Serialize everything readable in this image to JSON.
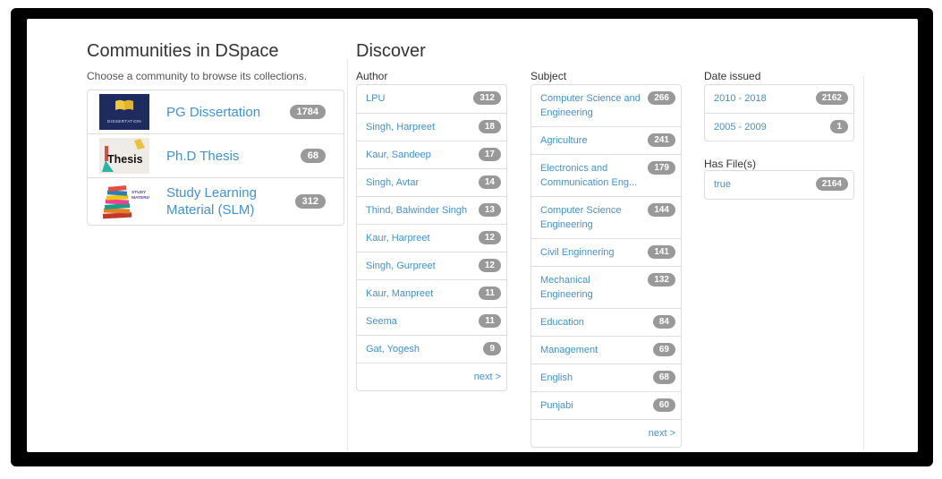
{
  "colors": {
    "link_blue": "#4191d6",
    "badge_gray": "#999999",
    "frame_black": "#000000",
    "divider_gray": "#e7e7e7"
  },
  "communities": {
    "title": "Communities in DSpace",
    "subtitle": "Choose a community to browse its collections.",
    "items": [
      {
        "name": "PG Dissertation",
        "count": "1784",
        "icon": "dissertation-logo",
        "icon_text": "DISSERTATION"
      },
      {
        "name": "Ph.D Thesis",
        "count": "68",
        "icon": "thesis-logo",
        "icon_text": "Thesis"
      },
      {
        "name": "Study Learning Material (SLM)",
        "count": "312",
        "icon": "slm-logo",
        "icon_lines": [
          "STUDY",
          "MATERIAL"
        ]
      }
    ]
  },
  "discover": {
    "title": "Discover",
    "facets": {
      "author": {
        "label": "Author",
        "items": [
          {
            "label": "LPU",
            "count": "312"
          },
          {
            "label": "Singh, Harpreet",
            "count": "18"
          },
          {
            "label": "Kaur, Sandeep",
            "count": "17"
          },
          {
            "label": "Singh, Avtar",
            "count": "14"
          },
          {
            "label": "Thind, Balwinder Singh",
            "count": "13"
          },
          {
            "label": "Kaur, Harpreet",
            "count": "12"
          },
          {
            "label": "Singh, Gurpreet",
            "count": "12"
          },
          {
            "label": "Kaur, Manpreet",
            "count": "11"
          },
          {
            "label": "Seema",
            "count": "11"
          },
          {
            "label": "Gat, Yogesh",
            "count": "9"
          }
        ],
        "next_label": "next >"
      },
      "subject": {
        "label": "Subject",
        "items": [
          {
            "label": "Computer Science and Engineering",
            "count": "266"
          },
          {
            "label": "Agriculture",
            "count": "241"
          },
          {
            "label": "Electronics and Communication Eng...",
            "count": "179"
          },
          {
            "label": "Computer Science Engineering",
            "count": "144"
          },
          {
            "label": "Civil Enginnering",
            "count": "141"
          },
          {
            "label": "Mechanical Engineering",
            "count": "132"
          },
          {
            "label": "Education",
            "count": "84"
          },
          {
            "label": "Management",
            "count": "69"
          },
          {
            "label": "English",
            "count": "68"
          },
          {
            "label": "Punjabi",
            "count": "60"
          }
        ],
        "next_label": "next >"
      },
      "date_issued": {
        "label": "Date issued",
        "items": [
          {
            "label": "2010 - 2018",
            "count": "2162"
          },
          {
            "label": "2005 - 2009",
            "count": "1"
          }
        ]
      },
      "has_files": {
        "label": "Has File(s)",
        "items": [
          {
            "label": "true",
            "count": "2164"
          }
        ]
      }
    }
  }
}
